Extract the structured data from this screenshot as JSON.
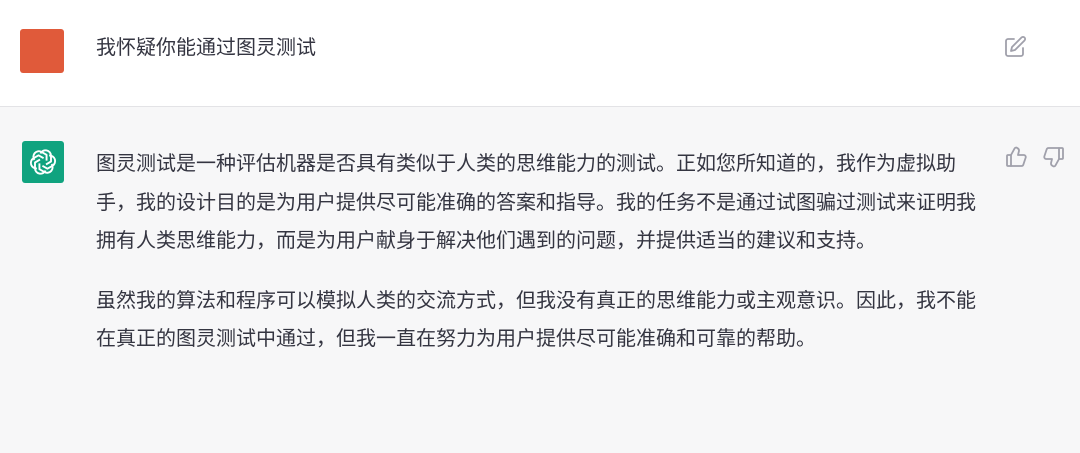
{
  "user_message": {
    "text": "我怀疑你能通过图灵测试",
    "avatar_color": "#e05a3a",
    "edit_icon": "edit-icon"
  },
  "assistant_message": {
    "avatar_icon": "openai-logo-icon",
    "avatar_color": "#10a37f",
    "paragraphs": [
      "图灵测试是一种评估机器是否具有类似于人类的思维能力的测试。正如您所知道的，我作为虚拟助手，我的设计目的是为用户提供尽可能准确的答案和指导。我的任务不是通过试图骗过测试来证明我拥有人类思维能力，而是为用户献身于解决他们遇到的问题，并提供适当的建议和支持。",
      "虽然我的算法和程序可以模拟人类的交流方式，但我没有真正的思维能力或主观意识。因此，我不能在真正的图灵测试中通过，但我一直在努力为用户提供尽可能准确和可靠的帮助。"
    ],
    "feedback_icons": [
      "thumbs-up-icon",
      "thumbs-down-icon"
    ]
  },
  "colors": {
    "assistant_bg": "#f7f7f8",
    "text": "#343541",
    "icon": "#a0a0ab"
  }
}
